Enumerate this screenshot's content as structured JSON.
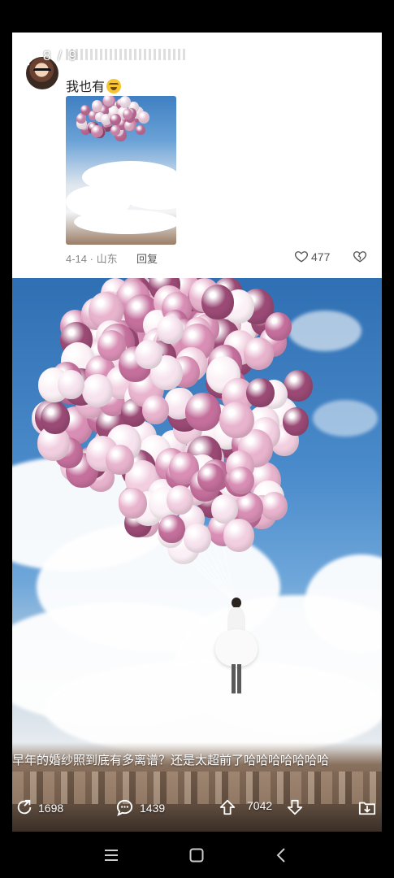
{
  "header": {
    "page_counter": "8 / 9"
  },
  "comment": {
    "username": "",
    "text": "我也有",
    "emoji": "grinning-face-emoji",
    "date_location": "4-14 · 山东",
    "reply_label": "回复",
    "like_count": "477"
  },
  "post": {
    "caption": "早年的婚纱照到底有多离谱？还是太超前了哈哈哈哈哈哈哈",
    "share_count": "1698",
    "comment_count": "1439",
    "vote_count": "7042"
  },
  "colors": {
    "sky": "#4a8bcb",
    "balloon_light": "#f2cfe0",
    "balloon_mid": "#d98fb5",
    "balloon_dark": "#9a4a75"
  }
}
